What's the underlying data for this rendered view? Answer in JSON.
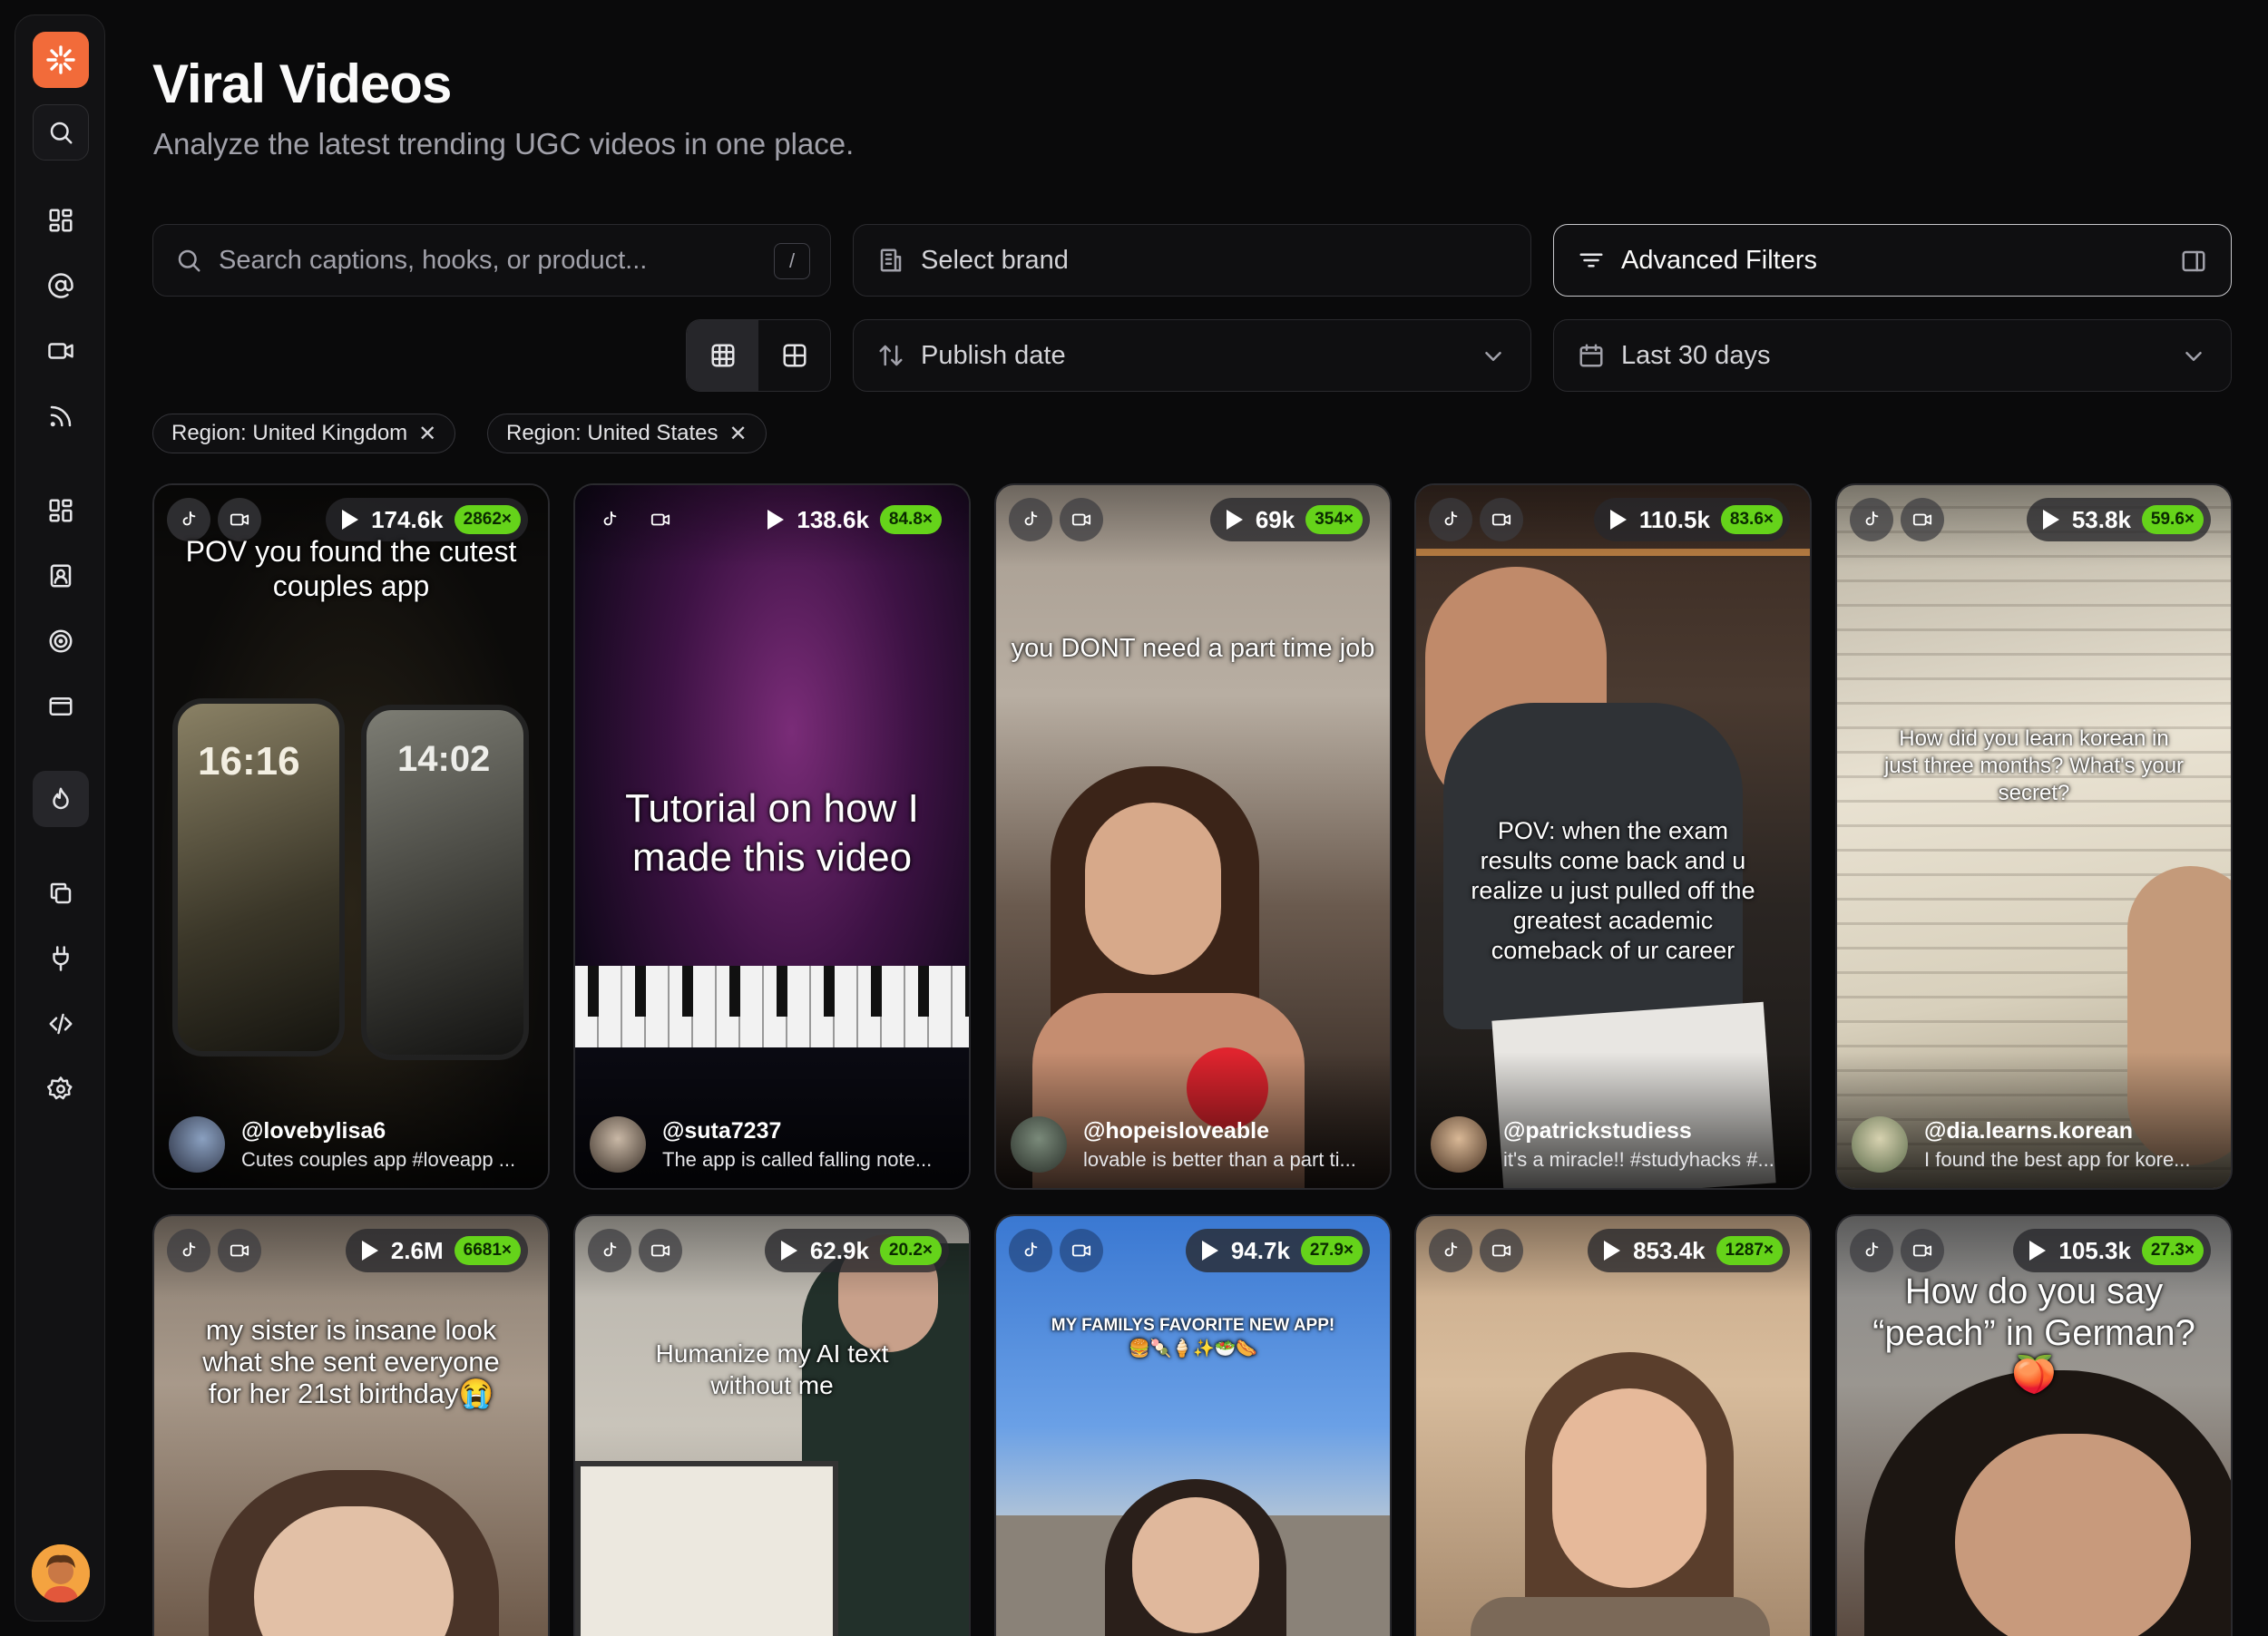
{
  "page": {
    "title": "Viral Videos",
    "subtitle": "Analyze the latest trending UGC videos in one place."
  },
  "sidebar": {
    "icons": [
      "logo-icon",
      "search-icon",
      "dashboard-icon",
      "at-icon",
      "video-icon",
      "rss-icon",
      "grid-icon",
      "id-badge-icon",
      "target-icon",
      "wallet-icon",
      "flame-icon",
      "copy-icon",
      "plug-icon",
      "code-icon",
      "settings-icon"
    ]
  },
  "search": {
    "placeholder": "Search captions, hooks, or product...",
    "shortcut": "/"
  },
  "brand": {
    "label": "Select brand"
  },
  "advanced": {
    "label": "Advanced Filters"
  },
  "sort": {
    "label": "Publish date"
  },
  "range": {
    "label": "Last 30 days"
  },
  "filters": [
    {
      "label": "Region: United Kingdom"
    },
    {
      "label": "Region: United States"
    }
  ],
  "accent": "#f26b3a",
  "badge_color": "#65d31a",
  "cards": [
    {
      "views": "174.6k",
      "mult": "2862×",
      "caption": "POV you found the cutest couples app",
      "handle": "@lovebylisa6",
      "desc": "Cutes couples app #loveapp ..."
    },
    {
      "views": "138.6k",
      "mult": "84.8×",
      "caption": "Tutorial on how I made this video",
      "handle": "@suta7237",
      "desc": "The app is called falling note..."
    },
    {
      "views": "69k",
      "mult": "354×",
      "caption": "you DONT need a part time job",
      "handle": "@hopeisloveable",
      "desc": "lovable is better than a part ti..."
    },
    {
      "views": "110.5k",
      "mult": "83.6×",
      "caption": "POV: when the exam results come back and u realize u just pulled off the greatest academic comeback of ur career",
      "handle": "@patrickstudiess",
      "desc": "it's a miracle!! #studyhacks #..."
    },
    {
      "views": "53.8k",
      "mult": "59.6×",
      "caption": "How did you learn korean in just three months? What's your secret?",
      "handle": "@dia.learns.korean",
      "desc": "I found the best app for kore..."
    },
    {
      "views": "2.6M",
      "mult": "6681×",
      "caption": "my sister is insane look what she sent everyone for her 21st birthday😭"
    },
    {
      "views": "62.9k",
      "mult": "20.2×",
      "caption": "Humanize my AI text without me"
    },
    {
      "views": "94.7k",
      "mult": "27.9×",
      "caption": "MY FAMILYS FAVORITE NEW APP! 🍔🍡🍦✨🥗🌭"
    },
    {
      "views": "853.4k",
      "mult": "1287×",
      "caption": ""
    },
    {
      "views": "105.3k",
      "mult": "27.3×",
      "caption": "How do you say “peach” in German? 🍑"
    }
  ]
}
